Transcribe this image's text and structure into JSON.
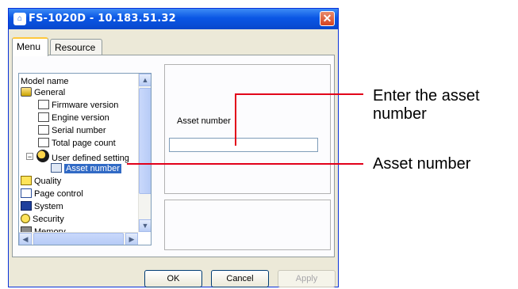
{
  "window": {
    "title": "FS-1020D - 10.183.51.32",
    "app_icon": "printer-app-icon",
    "close_glyph": "✕"
  },
  "tabs": [
    {
      "label": "Menu"
    },
    {
      "label": "Resource"
    }
  ],
  "tree": {
    "items": [
      {
        "label": "Model name",
        "icon": "none"
      },
      {
        "label": "General",
        "icon": "general-icon"
      },
      {
        "label": "Firmware version",
        "icon": "ver-doc-icon"
      },
      {
        "label": "Engine version",
        "icon": "ver-doc-icon"
      },
      {
        "label": "Serial number",
        "icon": "doc-icon"
      },
      {
        "label": "Total page count",
        "icon": "doc-icon"
      },
      {
        "label": "User defined setting",
        "icon": "user-icon"
      },
      {
        "label": "Asset number",
        "icon": "asset-icon"
      },
      {
        "label": "Quality",
        "icon": "quality-icon"
      },
      {
        "label": "Page control",
        "icon": "page-control-icon"
      },
      {
        "label": "System",
        "icon": "system-icon"
      },
      {
        "label": "Security",
        "icon": "security-icon"
      },
      {
        "label": "Memory",
        "icon": "memory-icon"
      }
    ],
    "collapse_glyph": "−",
    "selected": "Asset number"
  },
  "form": {
    "asset_label": "Asset number",
    "asset_value": ""
  },
  "buttons": {
    "ok": "OK",
    "cancel": "Cancel",
    "apply": "Apply"
  },
  "callouts": {
    "top": "Enter the asset number",
    "bottom": "Asset number"
  },
  "colors": {
    "callout": "#e2001a",
    "title_bar": "#0a56e5",
    "selection": "#316ac5"
  }
}
